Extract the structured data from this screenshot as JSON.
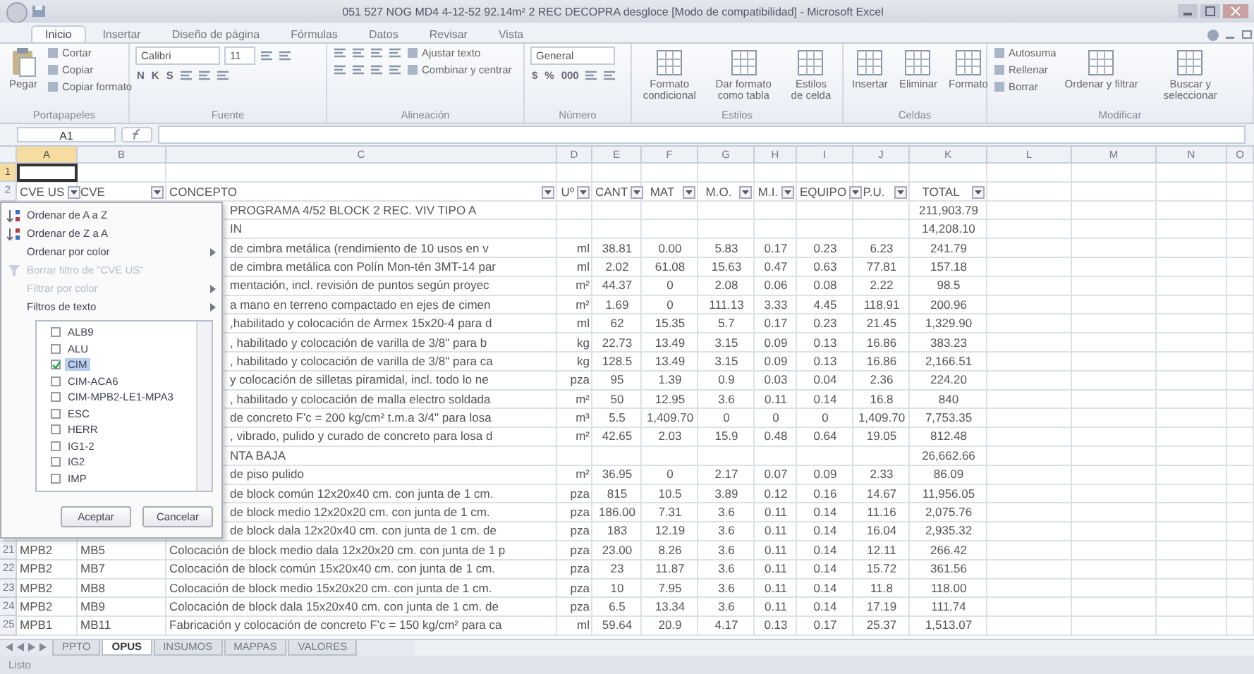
{
  "window": {
    "title": "051 527 NOG MD4 4-12-52 92.14m² 2 REC DECOPRA desgloce [Modo de compatibilidad] - Microsoft Excel"
  },
  "ribbon_tabs": [
    {
      "label": "Inicio",
      "selected": true
    },
    {
      "label": "Insertar",
      "selected": false
    },
    {
      "label": "Diseño de página",
      "selected": false
    },
    {
      "label": "Fórmulas",
      "selected": false
    },
    {
      "label": "Datos",
      "selected": false
    },
    {
      "label": "Revisar",
      "selected": false
    },
    {
      "label": "Vista",
      "selected": false
    }
  ],
  "ribbon_groups": [
    {
      "label": "Portapapeles",
      "blocks": [
        {
          "kind": "large",
          "text": "Pegar"
        },
        {
          "kind": "stack",
          "lines": [
            [
              {
                "kind": "small",
                "text": "Cortar"
              }
            ],
            [
              {
                "kind": "small",
                "text": "Copiar"
              }
            ],
            [
              {
                "kind": "small",
                "text": "Copiar formato"
              }
            ]
          ]
        }
      ]
    },
    {
      "label": "Fuente",
      "blocks": [
        {
          "kind": "stack",
          "lines": [
            [
              {
                "kind": "field",
                "text": "Calibri"
              },
              {
                "kind": "field",
                "text": "11"
              },
              {
                "kind": "icon"
              },
              {
                "kind": "icon"
              }
            ],
            [
              {
                "kind": "glyph",
                "text": "N"
              },
              {
                "kind": "glyph",
                "text": "K"
              },
              {
                "kind": "glyph",
                "text": "S"
              },
              {
                "kind": "icon"
              },
              {
                "kind": "icon"
              },
              {
                "kind": "icon"
              }
            ]
          ]
        }
      ]
    },
    {
      "label": "Alineación",
      "blocks": [
        {
          "kind": "stack",
          "lines": [
            [
              {
                "kind": "icon"
              },
              {
                "kind": "icon"
              },
              {
                "kind": "icon"
              },
              {
                "kind": "icon"
              },
              {
                "kind": "small",
                "text": "Ajustar texto"
              }
            ],
            [
              {
                "kind": "icon"
              },
              {
                "kind": "icon"
              },
              {
                "kind": "icon"
              },
              {
                "kind": "icon"
              },
              {
                "kind": "small",
                "text": "Combinar y centrar"
              }
            ]
          ]
        }
      ]
    },
    {
      "label": "Número",
      "blocks": [
        {
          "kind": "stack",
          "lines": [
            [
              {
                "kind": "field",
                "text": "General"
              }
            ],
            [
              {
                "kind": "glyph",
                "text": "$"
              },
              {
                "kind": "glyph",
                "text": "%"
              },
              {
                "kind": "glyph",
                "text": "000"
              },
              {
                "kind": "icon"
              },
              {
                "kind": "icon"
              }
            ]
          ]
        }
      ]
    },
    {
      "label": "Estilos",
      "blocks": [
        {
          "kind": "large",
          "text": "Formato condicional"
        },
        {
          "kind": "large",
          "text": "Dar formato como tabla"
        },
        {
          "kind": "large",
          "text": "Estilos de celda"
        }
      ]
    },
    {
      "label": "Celdas",
      "blocks": [
        {
          "kind": "large",
          "text": "Insertar"
        },
        {
          "kind": "large",
          "text": "Eliminar"
        },
        {
          "kind": "large",
          "text": "Formato"
        }
      ]
    },
    {
      "label": "Modificar",
      "blocks": [
        {
          "kind": "stack",
          "lines": [
            [
              {
                "kind": "small",
                "text": "Autosuma"
              }
            ],
            [
              {
                "kind": "small",
                "text": "Rellenar"
              }
            ],
            [
              {
                "kind": "small",
                "text": "Borrar"
              }
            ]
          ]
        },
        {
          "kind": "large",
          "text": "Ordenar y filtrar"
        },
        {
          "kind": "large",
          "text": "Buscar y seleccionar"
        }
      ]
    }
  ],
  "name_box": "A1",
  "columns": [
    {
      "label": "A",
      "selected": true
    },
    {
      "label": "B",
      "selected": false
    },
    {
      "label": "C",
      "selected": false
    },
    {
      "label": "D",
      "selected": false
    },
    {
      "label": "E",
      "selected": false
    },
    {
      "label": "F",
      "selected": false
    },
    {
      "label": "G",
      "selected": false
    },
    {
      "label": "H",
      "selected": false
    },
    {
      "label": "I",
      "selected": false
    },
    {
      "label": "J",
      "selected": false
    },
    {
      "label": "K",
      "selected": false
    },
    {
      "label": "L",
      "selected": false
    },
    {
      "label": "M",
      "selected": false
    },
    {
      "label": "N",
      "selected": false
    },
    {
      "label": "O",
      "selected": false
    }
  ],
  "rows": [
    {
      "number": "1",
      "selected": true,
      "cells": {}
    },
    {
      "number": "2",
      "selected": false,
      "header": true,
      "cells": {
        "A": "CVE US",
        "B": "CVE",
        "C": "CONCEPTO",
        "D": "Uº",
        "E": "CANT",
        "F": "MAT",
        "G": "M.O.",
        "H": "M.I.",
        "I": "EQUIPO",
        "J": "P.U.",
        "K": "TOTAL"
      }
    },
    {
      "cells": {
        "C": "PROGRAMA 4/52 BLOCK 2 REC. VIV TIPO A",
        "K": "211,903.79"
      }
    },
    {
      "cells": {
        "C": "IN",
        "K": "14,208.10"
      }
    },
    {
      "cells": {
        "C": "de cimbra metálica (rendimiento de 10 usos en v",
        "D": "ml",
        "E": "38.81",
        "F": "0.00",
        "G": "5.83",
        "H": "0.17",
        "I": "0.23",
        "J": "6.23",
        "K": "241.79"
      }
    },
    {
      "cells": {
        "C": "de cimbra metálica con Polín Mon-tén 3MT-14 par",
        "D": "ml",
        "E": "2.02",
        "F": "61.08",
        "G": "15.63",
        "H": "0.47",
        "I": "0.63",
        "J": "77.81",
        "K": "157.18"
      }
    },
    {
      "cells": {
        "C": "mentación, incl. revisión de puntos según proyec",
        "D": "m²",
        "E": "44.37",
        "F": "0",
        "G": "2.08",
        "H": "0.06",
        "I": "0.08",
        "J": "2.22",
        "K": "98.5"
      }
    },
    {
      "cells": {
        "C": "a mano en terreno compactado en ejes de cimen",
        "D": "m²",
        "E": "1.69",
        "F": "0",
        "G": "111.13",
        "H": "3.33",
        "I": "4.45",
        "J": "118.91",
        "K": "200.96"
      }
    },
    {
      "cells": {
        "C": ",habilitado y colocación de Armex 15x20-4 para d",
        "D": "ml",
        "E": "62",
        "F": "15.35",
        "G": "5.7",
        "H": "0.17",
        "I": "0.23",
        "J": "21.45",
        "K": "1,329.90"
      }
    },
    {
      "cells": {
        "C": ", habilitado y colocación de varilla de 3/8\" para b",
        "D": "kg",
        "E": "22.73",
        "F": "13.49",
        "G": "3.15",
        "H": "0.09",
        "I": "0.13",
        "J": "16.86",
        "K": "383.23"
      }
    },
    {
      "cells": {
        "C": ", habilitado y colocación de varilla de 3/8\" para ca",
        "D": "kg",
        "E": "128.5",
        "F": "13.49",
        "G": "3.15",
        "H": "0.09",
        "I": "0.13",
        "J": "16.86",
        "K": "2,166.51"
      }
    },
    {
      "cells": {
        "C": "y colocación de silletas piramidal, incl. todo lo ne",
        "D": "pza",
        "E": "95",
        "F": "1.39",
        "G": "0.9",
        "H": "0.03",
        "I": "0.04",
        "J": "2.36",
        "K": "224.20"
      }
    },
    {
      "cells": {
        "C": ", habilitado y colocación de malla electro soldada",
        "D": "m²",
        "E": "50",
        "F": "12.95",
        "G": "3.6",
        "H": "0.11",
        "I": "0.14",
        "J": "16.8",
        "K": "840"
      }
    },
    {
      "cells": {
        "C": "de concreto F'c = 200 kg/cm² t.m.a 3/4\" para losa",
        "D": "m³",
        "E": "5.5",
        "F": "1,409.70",
        "G": "0",
        "H": "0",
        "I": "0",
        "J": "1,409.70",
        "K": "7,753.35"
      }
    },
    {
      "cells": {
        "C": ", vibrado, pulido y curado de concreto para losa d",
        "D": "m²",
        "E": "42.65",
        "F": "2.03",
        "G": "15.9",
        "H": "0.48",
        "I": "0.64",
        "J": "19.05",
        "K": "812.48"
      }
    },
    {
      "cells": {
        "C": "NTA BAJA",
        "K": "26,662.66"
      }
    },
    {
      "cells": {
        "C": "de piso pulido",
        "D": "m²",
        "E": "36.95",
        "F": "0",
        "G": "2.17",
        "H": "0.07",
        "I": "0.09",
        "J": "2.33",
        "K": "86.09"
      }
    },
    {
      "cells": {
        "C": "de block común 12x20x40 cm. con junta de 1 cm.",
        "D": "pza",
        "E": "815",
        "F": "10.5",
        "G": "3.89",
        "H": "0.12",
        "I": "0.16",
        "J": "14.67",
        "K": "11,956.05"
      }
    },
    {
      "cells": {
        "C": "de block medio 12x20x20 cm. con junta de 1 cm.",
        "D": "pza",
        "E": "186.00",
        "F": "7.31",
        "G": "3.6",
        "H": "0.11",
        "I": "0.14",
        "J": "11.16",
        "K": "2,075.76"
      }
    },
    {
      "cells": {
        "C": "de block dala 12x20x40 cm. con junta de 1 cm. de",
        "D": "pza",
        "E": "183",
        "F": "12.19",
        "G": "3.6",
        "H": "0.11",
        "I": "0.14",
        "J": "16.04",
        "K": "2,935.32"
      }
    },
    {
      "number": "21",
      "selected": false,
      "cells": {
        "A": "MPB2",
        "B": "MB5",
        "C": "Colocación de block medio dala 12x20x20 cm. con junta de 1 p",
        "D": "pza",
        "E": "23.00",
        "F": "8.26",
        "G": "3.6",
        "H": "0.11",
        "I": "0.14",
        "J": "12.11",
        "K": "266.42"
      }
    },
    {
      "number": "22",
      "selected": false,
      "cells": {
        "A": "MPB2",
        "B": "MB7",
        "C": "Colocación de block común 15x20x40 cm. con junta de 1 cm.",
        "D": "pza",
        "E": "23",
        "F": "11.87",
        "G": "3.6",
        "H": "0.11",
        "I": "0.14",
        "J": "15.72",
        "K": "361.56"
      }
    },
    {
      "number": "23",
      "selected": false,
      "cells": {
        "A": "MPB2",
        "B": "MB8",
        "C": "Colocación de block medio 15x20x20 cm. con junta de 1 cm.",
        "D": "pza",
        "E": "10",
        "F": "7.95",
        "G": "3.6",
        "H": "0.11",
        "I": "0.14",
        "J": "11.8",
        "K": "118.00"
      }
    },
    {
      "number": "24",
      "selected": false,
      "cells": {
        "A": "MPB2",
        "B": "MB9",
        "C": "Colocación de block dala 15x20x40 cm. con junta de 1 cm. de",
        "D": "pza",
        "E": "6.5",
        "F": "13.34",
        "G": "3.6",
        "H": "0.11",
        "I": "0.14",
        "J": "17.19",
        "K": "111.74"
      }
    },
    {
      "number": "25",
      "selected": false,
      "cells": {
        "A": "MPB1",
        "B": "MB11",
        "C": "Fabricación y colocación de concreto F'c = 150 kg/cm² para ca",
        "D": "ml",
        "E": "59.64",
        "F": "20.9",
        "G": "4.17",
        "H": "0.13",
        "I": "0.17",
        "J": "25.37",
        "K": "1,513.07"
      }
    }
  ],
  "filter_menu": {
    "items": [
      {
        "label": "Ordenar de A a Z",
        "kind": "sort-asc",
        "disabled": false,
        "submenu": false
      },
      {
        "label": "Ordenar de Z a A",
        "kind": "sort-desc",
        "disabled": false,
        "submenu": false
      },
      {
        "label": "Ordenar por color",
        "kind": "plain",
        "disabled": false,
        "submenu": true
      },
      {
        "label": "Borrar filtro de \"CVE US\"",
        "kind": "clear",
        "disabled": true,
        "submenu": false
      },
      {
        "label": "Filtrar por color",
        "kind": "plain",
        "disabled": true,
        "submenu": true
      },
      {
        "label": "Filtros de texto",
        "kind": "plain",
        "disabled": false,
        "submenu": true
      }
    ],
    "values": [
      {
        "label": "ALB9",
        "checked": false,
        "selected": false
      },
      {
        "label": "ALU",
        "checked": false,
        "selected": false
      },
      {
        "label": "CIM",
        "checked": true,
        "selected": true
      },
      {
        "label": "CIM-ACA6",
        "checked": false,
        "selected": false
      },
      {
        "label": "CIM-MPB2-LE1-MPA3",
        "checked": false,
        "selected": false
      },
      {
        "label": "ESC",
        "checked": false,
        "selected": false
      },
      {
        "label": "HERR",
        "checked": false,
        "selected": false
      },
      {
        "label": "IG1-2",
        "checked": false,
        "selected": false
      },
      {
        "label": "IG2",
        "checked": false,
        "selected": false
      },
      {
        "label": "IMP",
        "checked": false,
        "selected": false
      }
    ],
    "buttons": [
      "Aceptar",
      "Cancelar"
    ]
  },
  "sheet_tabs": [
    {
      "label": "PPTO",
      "selected": false
    },
    {
      "label": "OPUS",
      "selected": true
    },
    {
      "label": "INSUMOS",
      "selected": false
    },
    {
      "label": "MAPPAS",
      "selected": false
    },
    {
      "label": "VALORES",
      "selected": false
    }
  ],
  "status_bar": {
    "text": "Listo"
  }
}
